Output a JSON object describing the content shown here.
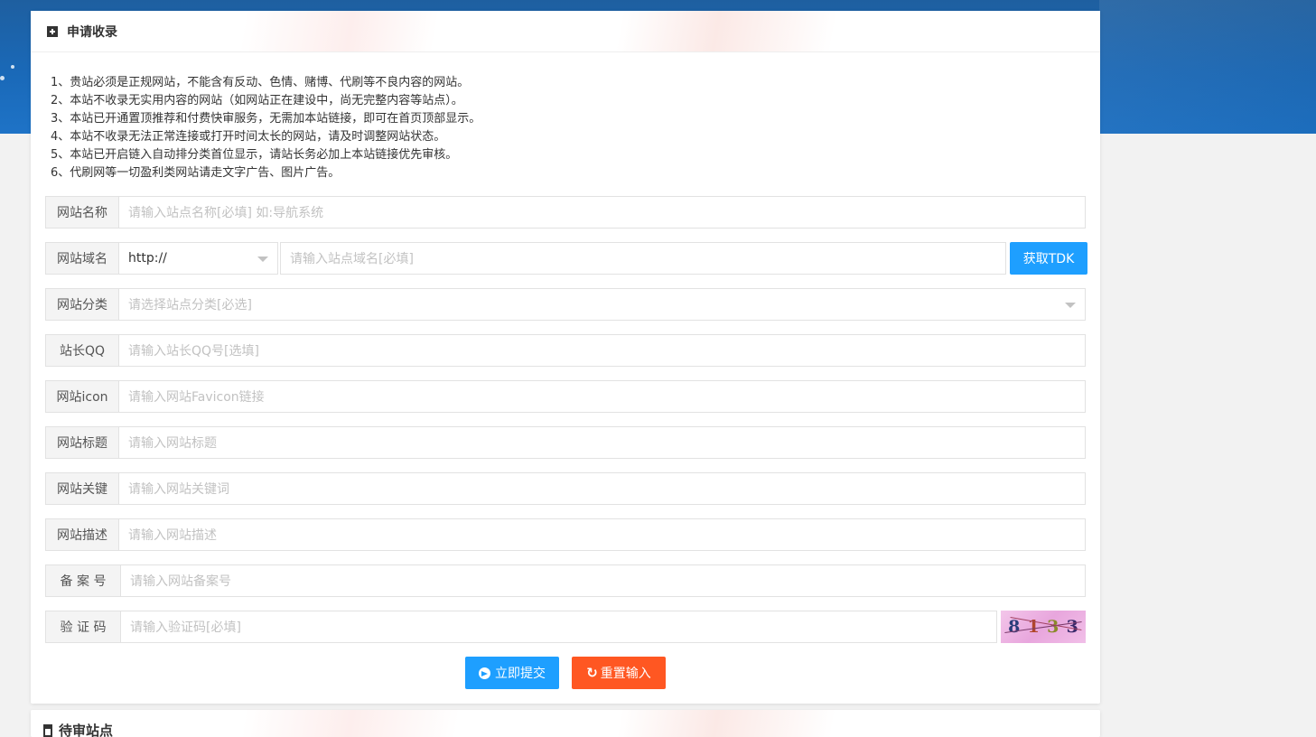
{
  "apply_card": {
    "title": "申请收录",
    "notes": [
      "1、贵站必须是正规网站，不能含有反动、色情、赌博、代刷等不良内容的网站。",
      "2、本站不收录无实用内容的网站（如网站正在建设中，尚无完整内容等站点）。",
      "3、本站已开通置顶推荐和付费快审服务，无需加本站链接，即可在首页顶部显示。",
      "4、本站不收录无法正常连接或打开时间太长的网站，请及时调整网站状态。",
      "5、本站已开启链入自动排分类首位显示，请站长务必加上本站链接优先审核。",
      "6、代刷网等一切盈利类网站请走文字广告、图片广告。"
    ],
    "fields": {
      "site_name": {
        "label": "网站名称",
        "placeholder": "请输入站点名称[必填] 如:导航系统"
      },
      "site_domain": {
        "label": "网站域名",
        "protocol": "http://",
        "placeholder": "请输入站点域名[必填]",
        "fetch_button": "获取TDK"
      },
      "site_category": {
        "label": "网站分类",
        "placeholder": "请选择站点分类[必选]"
      },
      "owner_qq": {
        "label": "站长QQ",
        "placeholder": "请输入站长QQ号[选填]"
      },
      "site_icon": {
        "label": "网站icon",
        "placeholder": "请输入网站Favicon链接"
      },
      "site_title": {
        "label": "网站标题",
        "placeholder": "请输入网站标题"
      },
      "site_keywords": {
        "label": "网站关键",
        "placeholder": "请输入网站关键词"
      },
      "site_description": {
        "label": "网站描述",
        "placeholder": "请输入网站描述"
      },
      "icp": {
        "label": "备 案 号",
        "placeholder": "请输入网站备案号"
      },
      "captcha": {
        "label": "验 证 码",
        "placeholder": "请输入验证码[必填]",
        "code": [
          "8",
          "1",
          "3",
          "3"
        ]
      }
    },
    "submit_label": "立即提交",
    "reset_label": "重置输入"
  },
  "pending_card": {
    "title": "待审站点"
  },
  "colors": {
    "primary": "#1e9fff",
    "danger": "#ff5722",
    "header_band": "#1a69b8"
  }
}
